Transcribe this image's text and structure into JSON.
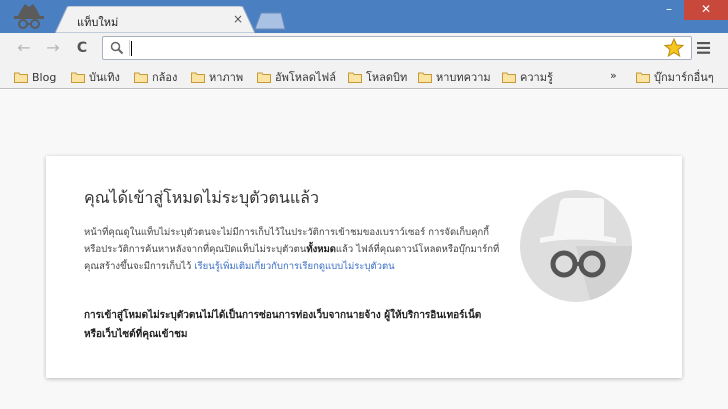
{
  "tab": {
    "title": "แท็บใหม่",
    "close": "×"
  },
  "window": {
    "minimize": "–",
    "close": "✕"
  },
  "toolbar": {
    "back": "←",
    "forward": "→",
    "reload": "C",
    "omnibox_value": ""
  },
  "bookmarks": {
    "items": [
      "Blog",
      "บันเทิง",
      "กล้อง",
      "หาภาพ",
      "อัพโหลดไฟล์",
      "โหลดบิท",
      "หาบทความ",
      "ความรู้"
    ],
    "more": "»",
    "other": "บุ๊กมาร์กอื่นๆ"
  },
  "incognito": {
    "heading": "คุณได้เข้าสู่โหมดไม่ระบุตัวตนแล้ว",
    "body_1": "หน้าที่คุณดูในแท็บไม่ระบุตัวตนจะไม่มีการเก็บไว้ในประวัติการเข้าชมของเบราว์เซอร์ การจัดเก็บคุกกี้ หรือประวัติการค้นหาหลังจากที่คุณปิดแท็บไม่ระบุตัวตน",
    "body_bold": "ทั้งหมด",
    "body_2": "แล้ว ไฟล์ที่คุณดาวน์โหลดหรือบุ๊กมาร์กที่คุณสร้างขึ้นจะมีการเก็บไว้ ",
    "link": "เรียนรู้เพิ่มเติมเกี่ยวกับการเรียกดูแบบไม่ระบุตัวตน",
    "warning": "การเข้าสู่โหมดไม่ระบุตัวตนไม่ได้เป็นการซ่อนการท่องเว็บจากนายจ้าง ผู้ให้บริการอินเทอร์เน็ต หรือเว็บไซต์ที่คุณเข้าชม"
  },
  "colors": {
    "titlebar": "#4a7fc1",
    "link": "#3a6fc4",
    "close_button": "#c9483c"
  }
}
